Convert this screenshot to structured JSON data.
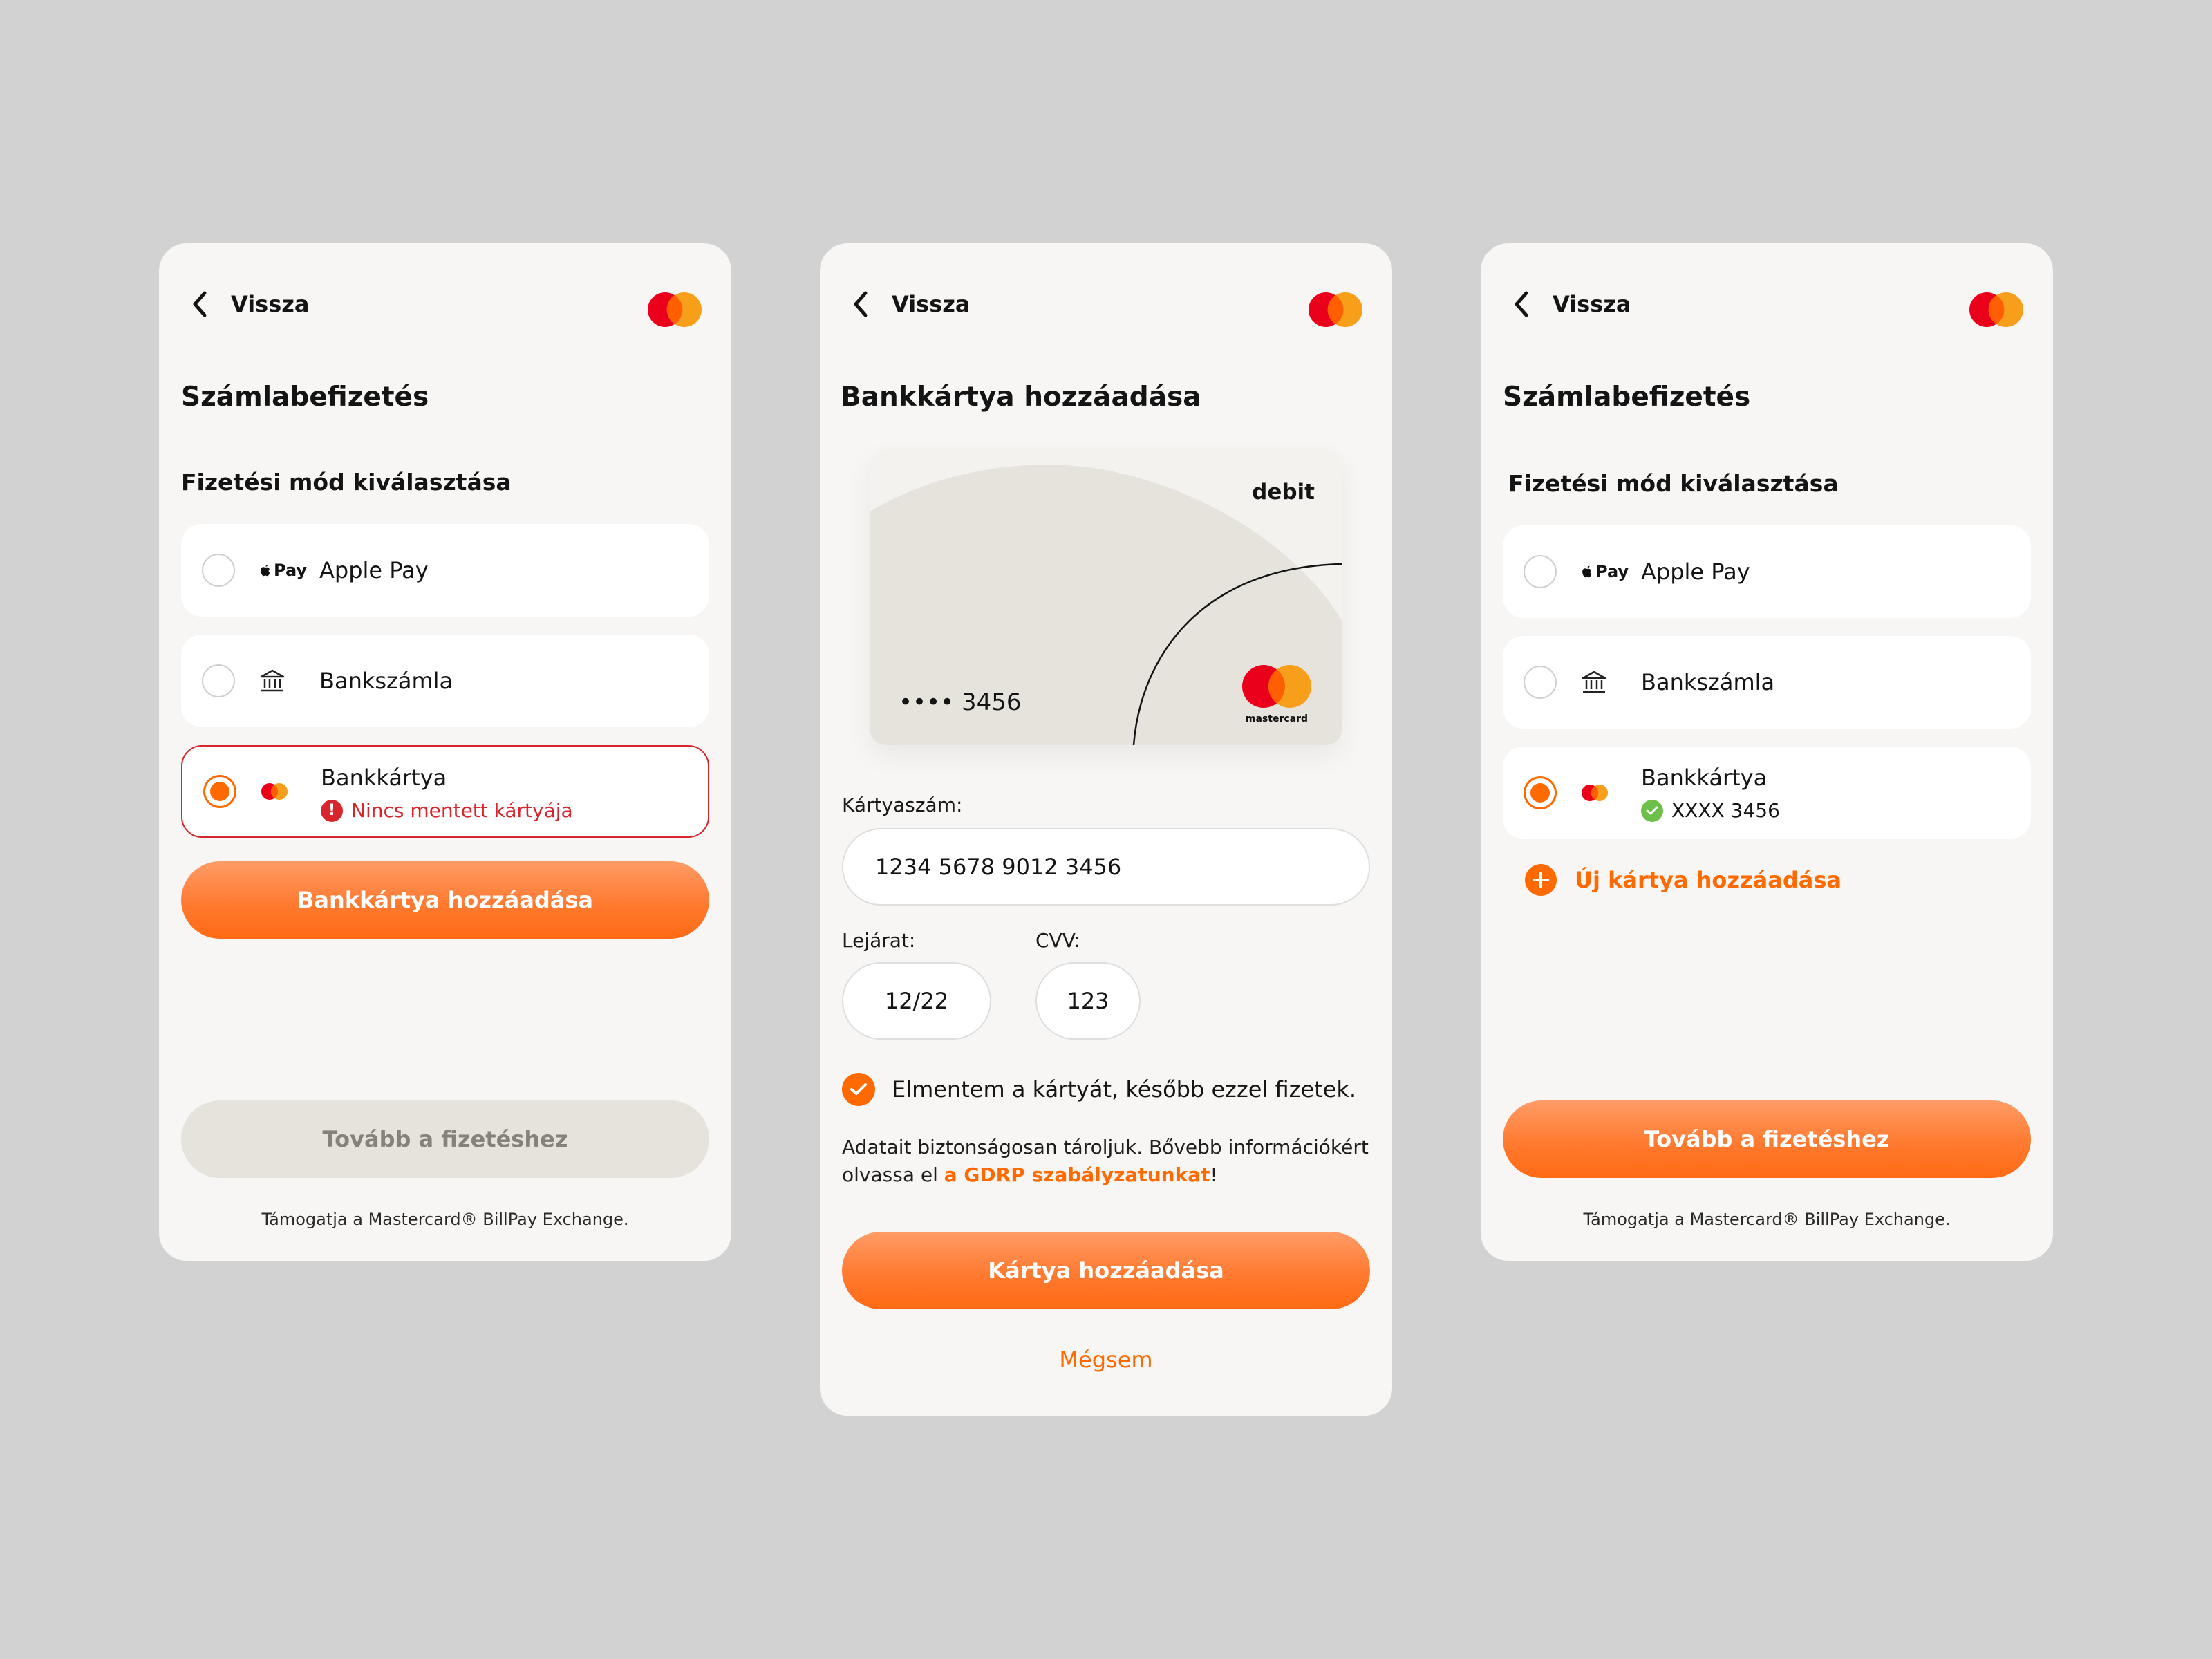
{
  "common": {
    "back_label": "Vissza",
    "footer_note": "Támogatja a Mastercard® BillPay Exchange.",
    "colors": {
      "accent": "#ff6a00",
      "error": "#d7262b",
      "success": "#6cc04a",
      "mc_red": "#eb001b",
      "mc_yellow": "#f79e1b"
    }
  },
  "screen1": {
    "title": "Számlabefizetés",
    "section_title": "Fizetési mód kiválasztása",
    "options": [
      {
        "label": "Apple Pay",
        "icon": "apple-pay-icon",
        "icon_text": "Pay",
        "selected": false
      },
      {
        "label": "Bankszámla",
        "icon": "bank-icon",
        "selected": false
      },
      {
        "label": "Bankkártya",
        "icon": "mastercard-icon",
        "selected": true,
        "sub": "Nincs mentett kártyája",
        "sub_icon": "!"
      }
    ],
    "add_card_button": "Bankkártya hozzáadása",
    "continue_button": "Tovább a fizetéshez"
  },
  "screen2": {
    "title": "Bankkártya hozzáadása",
    "card": {
      "type_label": "debit",
      "masked_number": "•••• 3456",
      "brand_text": "mastercard"
    },
    "card_number_label": "Kártyaszám:",
    "card_number_value": "1234 5678 9012 3456",
    "expiry_label": "Lejárat:",
    "expiry_value": "12/22",
    "cvv_label": "CVV:",
    "cvv_value": "123",
    "save_card_label": "Elmentem a kártyát, később ezzel fizetek.",
    "save_card_checked": true,
    "privacy_text_1": "Adatait biztonságosan tároljuk. Bővebb információkért olvassa el ",
    "privacy_link": "a GDRP szabályzatunkat",
    "privacy_text_2": "!",
    "add_button": "Kártya hozzáadása",
    "cancel_label": "Mégsem"
  },
  "screen3": {
    "title": "Számlabefizetés",
    "section_title": "Fizetési mód kiválasztása",
    "options": [
      {
        "label": "Apple Pay",
        "icon": "apple-pay-icon",
        "icon_text": "Pay",
        "selected": false
      },
      {
        "label": "Bankszámla",
        "icon": "bank-icon",
        "selected": false
      },
      {
        "label": "Bankkártya",
        "icon": "mastercard-icon",
        "selected": true,
        "sub": "XXXX 3456"
      }
    ],
    "new_card_link": "Új kártya hozzáadása",
    "continue_button": "Tovább a fizetéshez"
  }
}
